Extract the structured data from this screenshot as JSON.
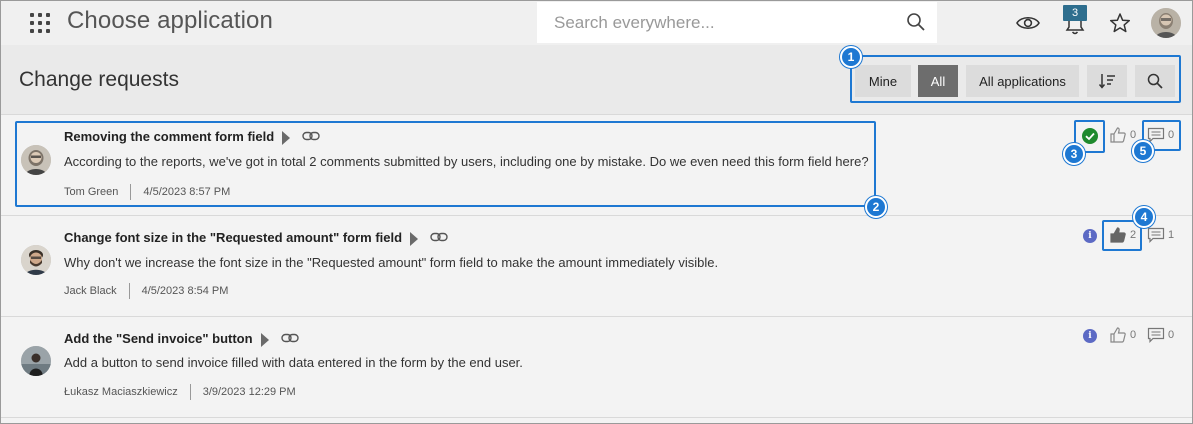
{
  "topbar": {
    "app_title": "Choose application",
    "search_placeholder": "Search everywhere...",
    "notification_count": "3"
  },
  "header": {
    "title": "Change requests",
    "filters": {
      "mine": "Mine",
      "all": "All",
      "all_applications": "All applications"
    }
  },
  "markers": [
    "1",
    "2",
    "3",
    "4",
    "5"
  ],
  "requests": [
    {
      "title": "Removing the comment form field",
      "description": "According to the reports, we've got in total 2 comments submitted by users, including one by mistake. Do we even need this form field here?",
      "author": "Tom Green",
      "date": "4/5/2023 8:57 PM",
      "likes": "0",
      "comments": "0",
      "status": "approved",
      "liked": false
    },
    {
      "title": "Change font size in the \"Requested amount\" form field",
      "description": "Why don't we increase the font size in the \"Requested amount\" form field to make the amount immediately visible.",
      "author": "Jack Black",
      "date": "4/5/2023 8:54 PM",
      "likes": "2",
      "comments": "1",
      "status": "info",
      "liked": true
    },
    {
      "title": "Add the \"Send invoice\" button",
      "description": "Add a button to send invoice filled with data entered in the form by the end user.",
      "author": "Łukasz Maciaszkiewicz",
      "date": "3/9/2023 12:29 PM",
      "likes": "0",
      "comments": "0",
      "status": "info",
      "liked": false
    }
  ],
  "colors": {
    "accent": "#1e78d2",
    "approved": "#1f8a2e",
    "info": "#5c6ac4",
    "active_filter": "#6d6d6d",
    "notification_badge": "#2e6e8e"
  }
}
